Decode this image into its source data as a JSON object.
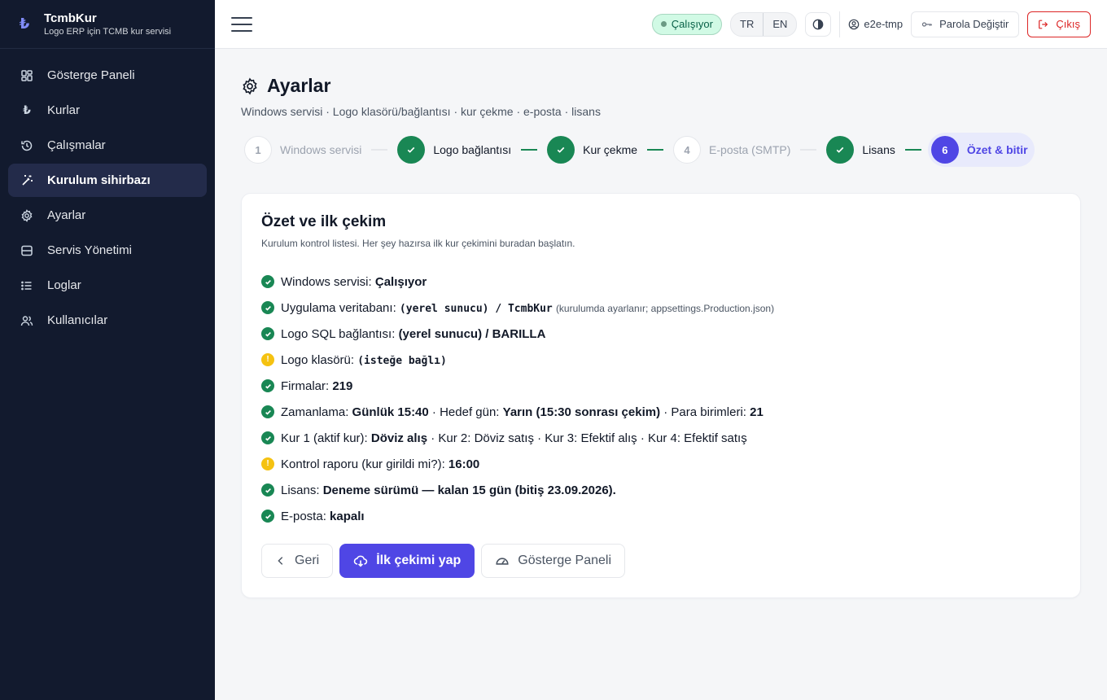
{
  "brand": {
    "name": "TcmbKur",
    "subtitle": "Logo ERP için TCMB kur servisi",
    "logo_glyph": "₺"
  },
  "sidebar": {
    "items": [
      {
        "label": "Gösterge Paneli",
        "icon": "dashboard-icon"
      },
      {
        "label": "Kurlar",
        "icon": "lira-icon"
      },
      {
        "label": "Çalışmalar",
        "icon": "history-icon"
      },
      {
        "label": "Kurulum sihirbazı",
        "icon": "wand-icon",
        "active": true
      },
      {
        "label": "Ayarlar",
        "icon": "gear-icon"
      },
      {
        "label": "Servis Yönetimi",
        "icon": "server-icon"
      },
      {
        "label": "Loglar",
        "icon": "list-icon"
      },
      {
        "label": "Kullanıcılar",
        "icon": "users-icon"
      }
    ]
  },
  "topbar": {
    "status": "Çalışıyor",
    "lang_tr": "TR",
    "lang_en": "EN",
    "user": "e2e-tmp",
    "change_password": "Parola Değiştir",
    "logout": "Çıkış"
  },
  "page": {
    "title": "Ayarlar",
    "subtitle": "Windows servisi · Logo klasörü/bağlantısı · kur çekme · e-posta · lisans"
  },
  "stepper": [
    {
      "num": "1",
      "label": "Windows servisi",
      "state": "pending"
    },
    {
      "num": "2",
      "label": "Logo bağlantısı",
      "state": "done"
    },
    {
      "num": "3",
      "label": "Kur çekme",
      "state": "done"
    },
    {
      "num": "4",
      "label": "E-posta (SMTP)",
      "state": "pending"
    },
    {
      "num": "5",
      "label": "Lisans",
      "state": "done"
    },
    {
      "num": "6",
      "label": "Özet & bitir",
      "state": "current"
    }
  ],
  "summary": {
    "title": "Özet ve ilk çekim",
    "subtitle": "Kurulum kontrol listesi. Her şey hazırsa ilk kur çekimini buradan başlatın.",
    "rows": {
      "service": {
        "label": "Windows servisi:",
        "value": "Çalışıyor"
      },
      "appdb": {
        "label": "Uygulama veritabanı:",
        "value": "(yerel sunucu) / TcmbKur",
        "note": "(kurulumda ayarlanır; appsettings.Production.json)"
      },
      "sql": {
        "label": "Logo SQL bağlantısı:",
        "value": "(yerel sunucu) / BARILLA"
      },
      "folder": {
        "label": "Logo klasörü:",
        "value": "(isteğe bağlı)"
      },
      "firms": {
        "label": "Firmalar:",
        "value": "219"
      },
      "schedule": {
        "label": "Zamanlama:",
        "value": "Günlük 15:40",
        "target_label": "· Hedef gün:",
        "target_value": "Yarın (15:30 sonrası çekim)",
        "currency_label": "· Para birimleri:",
        "currency_value": "21"
      },
      "rates": {
        "label": "Kur 1 (aktif kur):",
        "value": "Döviz alış",
        "rest": "· Kur 2: Döviz satış · Kur 3: Efektif alış · Kur 4: Efektif satış"
      },
      "report": {
        "label": "Kontrol raporu (kur girildi mi?):",
        "value": "16:00"
      },
      "license": {
        "label": "Lisans:",
        "value": "Deneme sürümü — kalan 15 gün (bitiş 23.09.2026)."
      },
      "email": {
        "label": "E-posta:",
        "value": "kapalı"
      }
    },
    "back_label": "Geri",
    "run_label": "İlk çekimi yap",
    "dashboard_label": "Gösterge Paneli"
  },
  "colors": {
    "accent": "#4f46e5",
    "success": "#198754",
    "warning": "#f5c211",
    "danger": "#dc2626",
    "sidebar": "#121a2e"
  }
}
